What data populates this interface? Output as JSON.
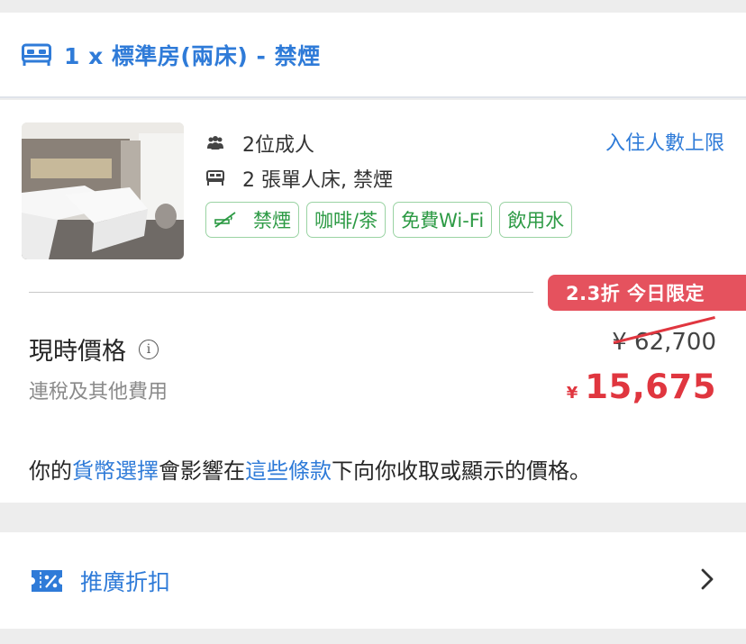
{
  "room": {
    "title": "1 x 標準房(兩床) - 禁煙",
    "guests": "2位成人",
    "beds": "2 張單人床, 禁煙",
    "occupancy_link": "入住人數上限",
    "amenities": [
      "禁煙",
      "咖啡/茶",
      "免費Wi-Fi",
      "飲用水"
    ]
  },
  "pricing": {
    "discount_badge": "2.3折 今日限定",
    "label": "現時價格",
    "info_symbol": "i",
    "subtitle": "連稅及其他費用",
    "original_price": "¥ 62,700",
    "currency_symbol": "¥",
    "final_price": "15,675"
  },
  "notice": {
    "part1": "你的",
    "link1": "貨幣選擇",
    "part2": "會影響在",
    "link2": "這些條款",
    "part3": "下向你收取或顯示的價格。"
  },
  "promo": {
    "label": "推廣折扣"
  },
  "colors": {
    "accent_blue": "#2f7bd8",
    "price_red": "#e0363f",
    "badge_red": "#e5525e",
    "amenity_green": "#2c9a44"
  }
}
